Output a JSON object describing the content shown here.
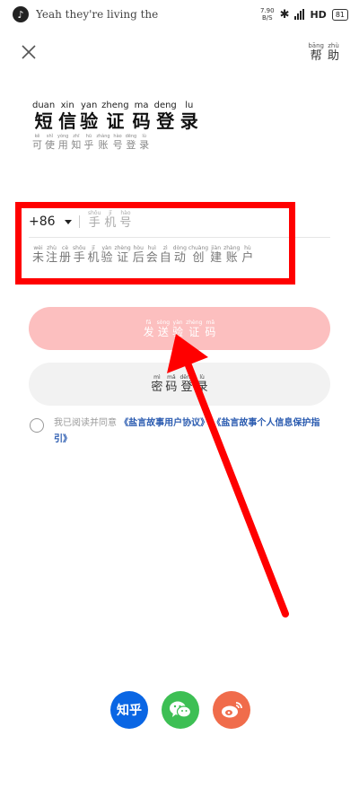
{
  "status_bar": {
    "song": "Yeah they're living the good",
    "net_speed_value": "7.90",
    "net_speed_unit": "B/S",
    "network": "HD",
    "battery": "81"
  },
  "header": {
    "help": [
      {
        "py": "bāng",
        "hz": "帮"
      },
      {
        "py": "zhù",
        "hz": "助"
      }
    ]
  },
  "title": [
    {
      "py": "duan",
      "hz": "短"
    },
    {
      "py": "xin",
      "hz": "信"
    },
    {
      "py": "yan",
      "hz": "验"
    },
    {
      "py": "zheng",
      "hz": "证"
    },
    {
      "py": "ma",
      "hz": "码"
    },
    {
      "py": "deng",
      "hz": "登"
    },
    {
      "py": "lu",
      "hz": "录"
    }
  ],
  "subtitle": [
    {
      "py": "kě",
      "hz": "可"
    },
    {
      "py": "shǐ",
      "hz": "使"
    },
    {
      "py": "yòng",
      "hz": "用"
    },
    {
      "py": "zhī",
      "hz": "知"
    },
    {
      "py": "hū",
      "hz": "乎"
    },
    {
      "py": "zhàng",
      "hz": "账"
    },
    {
      "py": "hào",
      "hz": "号"
    },
    {
      "py": "dēng",
      "hz": "登"
    },
    {
      "py": "lù",
      "hz": "录"
    }
  ],
  "phone": {
    "country_code": "+86",
    "placeholder": [
      {
        "py": "shǒu",
        "hz": "手"
      },
      {
        "py": "jī",
        "hz": "机"
      },
      {
        "py": "hào",
        "hz": "号"
      }
    ]
  },
  "hint": [
    {
      "py": "wèi",
      "hz": "未"
    },
    {
      "py": "zhù",
      "hz": "注"
    },
    {
      "py": "cè",
      "hz": "册"
    },
    {
      "py": "shǒu",
      "hz": "手"
    },
    {
      "py": "jī",
      "hz": "机"
    },
    {
      "py": "yàn",
      "hz": "验"
    },
    {
      "py": "zhèng",
      "hz": "证"
    },
    {
      "py": "hòu",
      "hz": "后"
    },
    {
      "py": "huì",
      "hz": "会"
    },
    {
      "py": "zì",
      "hz": "自"
    },
    {
      "py": "dòng",
      "hz": "动"
    },
    {
      "py": "chuàng",
      "hz": "创"
    },
    {
      "py": "jiàn",
      "hz": "建"
    },
    {
      "py": "zhàng",
      "hz": "账"
    },
    {
      "py": "hù",
      "hz": "户"
    }
  ],
  "send_button": [
    {
      "py": "fā",
      "hz": "发"
    },
    {
      "py": "sòng",
      "hz": "送"
    },
    {
      "py": "yàn",
      "hz": "验"
    },
    {
      "py": "zhèng",
      "hz": "证"
    },
    {
      "py": "mǎ",
      "hz": "码"
    }
  ],
  "password_button": [
    {
      "py": "mì",
      "hz": "密"
    },
    {
      "py": "mǎ",
      "hz": "码"
    },
    {
      "py": "dēng",
      "hz": "登"
    },
    {
      "py": "lù",
      "hz": "录"
    }
  ],
  "agreement": {
    "prefix": "我已阅读并同意",
    "link1": "《盐言故事用户协议》",
    "link2": "《盐言故事个人信息保护指引》"
  },
  "social": {
    "zhihu_label": "知乎",
    "colors": {
      "zhihu": "#0a66e4",
      "wechat": "#3dbf54",
      "weibo": "#f06c4b"
    }
  }
}
